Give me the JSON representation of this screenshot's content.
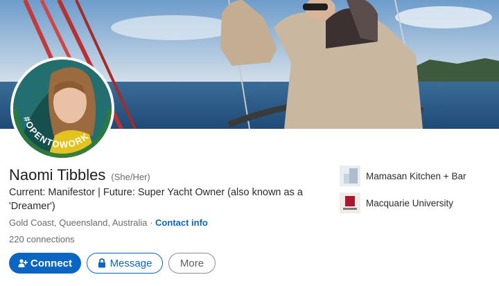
{
  "profile": {
    "name": "Naomi Tibbles",
    "pronouns": "(She/Her)",
    "headline": "Current: Manifestor | Future: Super Yacht Owner (also known as a 'Dreamer')",
    "location": "Gold Coast, Queensland, Australia",
    "location_separator": "·",
    "contact_info": "Contact info",
    "connections": "220 connections",
    "open_to_work_badge": "#OPENTOWORK"
  },
  "actions": {
    "connect": "Connect",
    "message": "Message",
    "more": "More"
  },
  "experience": [
    {
      "name": "Mamasan Kitchen + Bar",
      "icon": "company-logo"
    },
    {
      "name": "Macquarie University",
      "icon": "university-logo"
    }
  ],
  "colors": {
    "primary": "#0a66c2",
    "badge_green": "#2c7a3b",
    "text": "#1d1d1d",
    "muted": "#6b6b6b"
  }
}
